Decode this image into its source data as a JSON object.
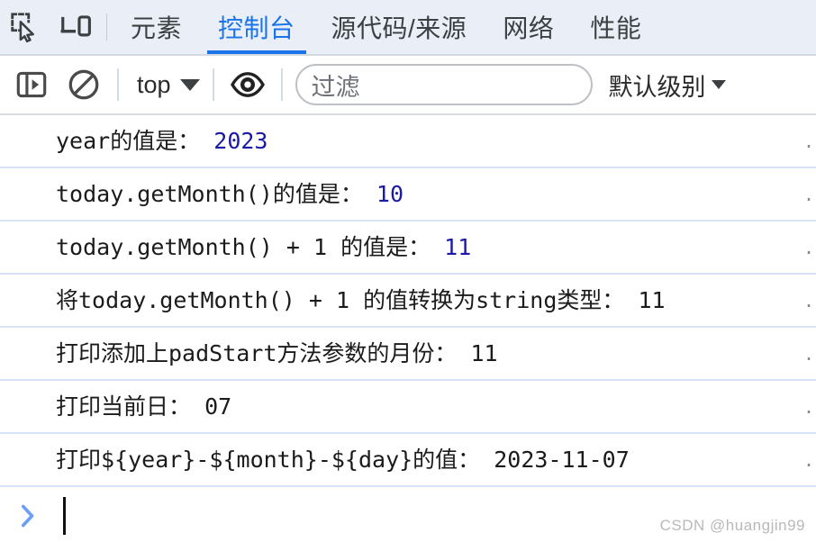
{
  "tabbar": {
    "icons": [
      {
        "name": "inspect-element-icon",
        "label": "检查元素"
      },
      {
        "name": "device-toolbar-icon",
        "label": "设备工具栏"
      }
    ],
    "tabs": [
      {
        "label": "元素",
        "active": false
      },
      {
        "label": "控制台",
        "active": true
      },
      {
        "label": "源代码/来源",
        "active": false
      },
      {
        "label": "网络",
        "active": false
      },
      {
        "label": "性能",
        "active": false
      }
    ],
    "accent_color": "#1a73e8",
    "background_color": "#eaeff7"
  },
  "console_toolbar": {
    "sidebar_toggle_icon": "show-console-sidebar-icon",
    "clear_icon": "clear-console-icon",
    "context_label": "top",
    "eye_icon": "live-expression-eye-icon",
    "filter_placeholder": "过滤",
    "filter_value": "",
    "levels_label": "默认级别"
  },
  "console": {
    "messages": [
      {
        "parts": [
          {
            "text": "year的值是：",
            "kind": "text"
          },
          {
            "text": "2023",
            "kind": "number"
          }
        ],
        "source": "."
      },
      {
        "parts": [
          {
            "text": "today.getMonth()的值是：",
            "kind": "text"
          },
          {
            "text": "10",
            "kind": "number"
          }
        ],
        "source": "."
      },
      {
        "parts": [
          {
            "text": "today.getMonth() + 1 的值是：",
            "kind": "text"
          },
          {
            "text": "11",
            "kind": "number"
          }
        ],
        "source": "."
      },
      {
        "parts": [
          {
            "text": "将today.getMonth() + 1 的值转换为string类型：",
            "kind": "text"
          },
          {
            "text": "11",
            "kind": "text"
          }
        ],
        "source": "."
      },
      {
        "parts": [
          {
            "text": "打印添加上padStart方法参数的月份：",
            "kind": "text"
          },
          {
            "text": "11",
            "kind": "text"
          }
        ],
        "source": "."
      },
      {
        "parts": [
          {
            "text": "打印当前日：",
            "kind": "text"
          },
          {
            "text": "07",
            "kind": "text"
          }
        ],
        "source": "."
      },
      {
        "parts": [
          {
            "text": "打印${year}-${month}-${day}的值：",
            "kind": "text"
          },
          {
            "text": "2023-11-07",
            "kind": "text"
          }
        ],
        "source": "."
      }
    ],
    "number_color": "#1a1aa6",
    "text_color": "#1b1b1b",
    "separator_color": "#d6e2f7"
  },
  "prompt": {
    "chevron_icon": "prompt-chevron-icon",
    "chevron_color": "#6b9ef5",
    "input_value": ""
  },
  "watermark": {
    "text": "CSDN @huangjin99"
  }
}
